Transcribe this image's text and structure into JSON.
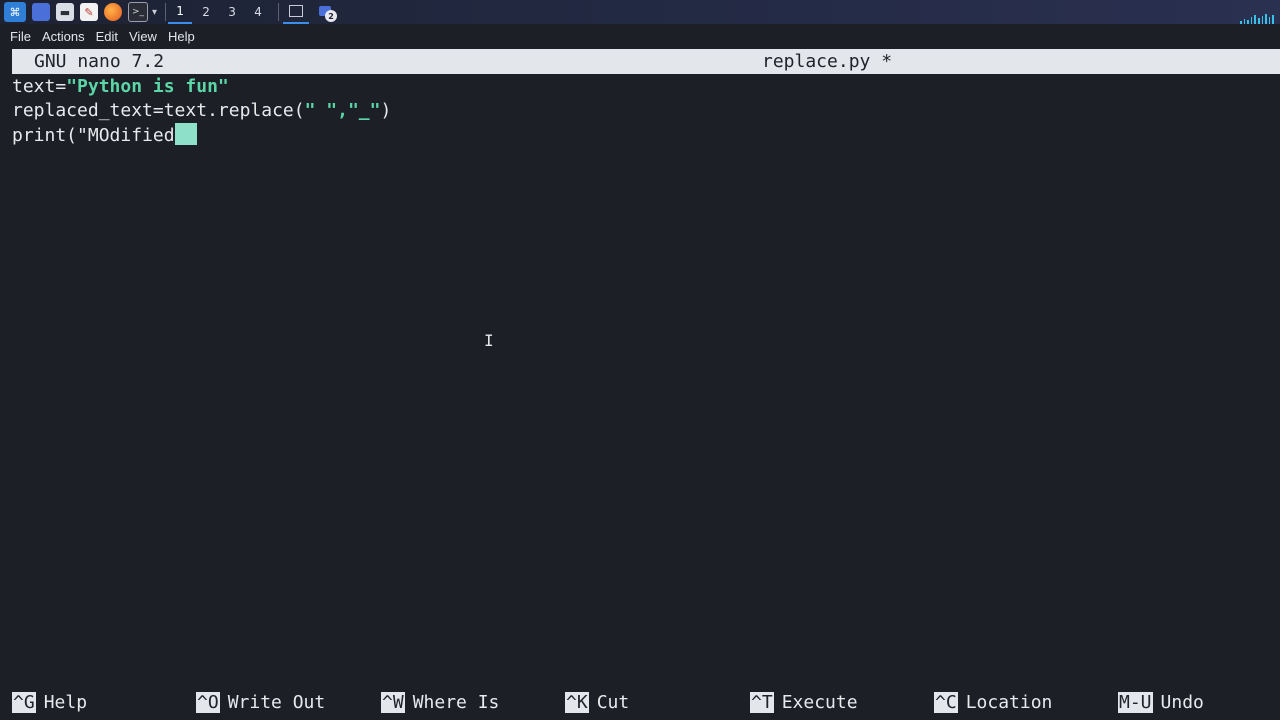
{
  "taskbar": {
    "workspaces": [
      "1",
      "2",
      "3",
      "4"
    ],
    "active_workspace": "1",
    "badge_count": "2",
    "accent_color": "#3b8eea"
  },
  "menubar": {
    "items": [
      "File",
      "Actions",
      "Edit",
      "View",
      "Help"
    ]
  },
  "nano": {
    "program": "GNU nano 7.2",
    "filename": "replace.py *",
    "lines": [
      {
        "plain": "text=",
        "string": "\"Python is fun\"",
        "rest": ""
      },
      {
        "plain": "replaced_text=text.replace(",
        "string": "\" \",\"_\"",
        "rest": ")"
      },
      {
        "plain": "print(\"MOdified",
        "string": "",
        "rest": ""
      }
    ],
    "string_color": "#5bd6a6"
  },
  "shortcuts": [
    {
      "key": "^G",
      "label": "Help"
    },
    {
      "key": "^O",
      "label": "Write Out"
    },
    {
      "key": "^W",
      "label": "Where Is"
    },
    {
      "key": "^K",
      "label": "Cut"
    },
    {
      "key": "^T",
      "label": "Execute"
    },
    {
      "key": "^C",
      "label": "Location"
    },
    {
      "key": "M-U",
      "label": "Undo"
    }
  ]
}
